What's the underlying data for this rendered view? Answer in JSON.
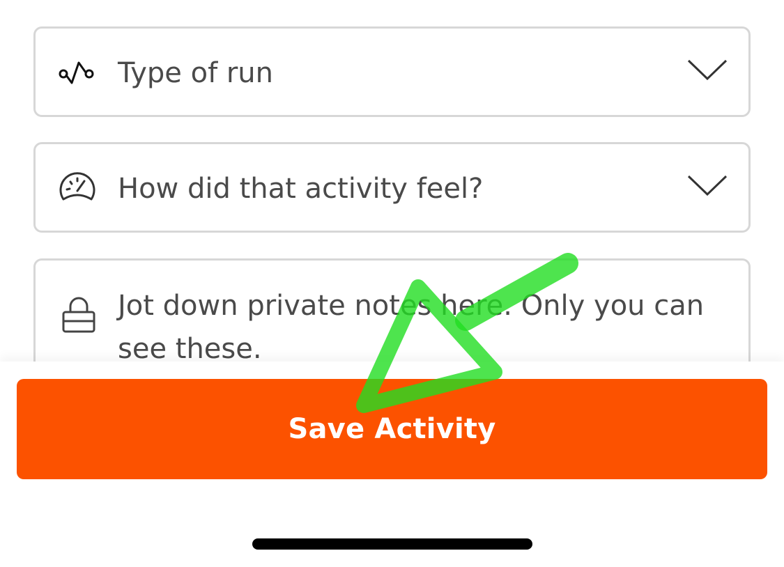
{
  "form": {
    "run_type": {
      "placeholder": "Type of run",
      "icon": "workout-route-icon"
    },
    "perceived_exertion": {
      "placeholder": "How did that activity feel?",
      "icon": "speedometer-icon"
    },
    "private_notes": {
      "placeholder": "Jot down private notes here. Only you can see these.",
      "icon": "lock-icon"
    }
  },
  "actions": {
    "save_label": "Save Activity"
  },
  "colors": {
    "accent": "#fc5200",
    "field_border": "#d7d7d7",
    "text": "#4a4a4a",
    "annotation": "#22dd22"
  }
}
